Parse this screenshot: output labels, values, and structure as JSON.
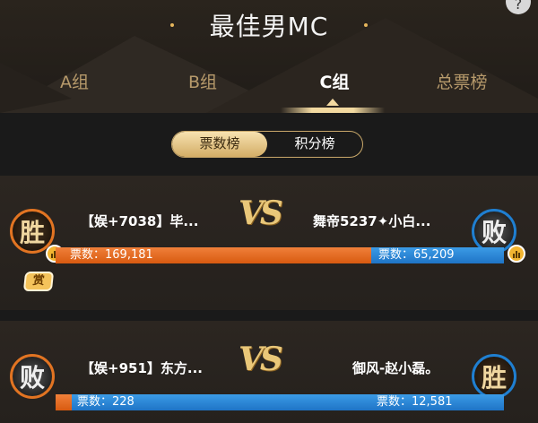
{
  "header": {
    "title": "最佳男MC",
    "tabs": [
      {
        "label": "A组",
        "active": false
      },
      {
        "label": "B组",
        "active": false
      },
      {
        "label": "C组",
        "active": true
      },
      {
        "label": "总票榜",
        "active": false
      }
    ]
  },
  "toggle": {
    "options": [
      "票数榜",
      "积分榜"
    ],
    "selected": "票数榜"
  },
  "matches": [
    {
      "left": {
        "name": "【娱+7038】毕...",
        "result": "胜",
        "votes": "票数：169,181"
      },
      "right": {
        "name": "舞帝5237✦小白...",
        "result": "败",
        "votes": "票数：65,209"
      },
      "vs": "VS",
      "reward": "赏"
    },
    {
      "left": {
        "name": "【娱+951】东方...",
        "result": "败",
        "votes": "票数：228"
      },
      "right": {
        "name": "御风-赵小磊。",
        "result": "胜",
        "votes": "票数：12,581"
      },
      "vs": "VS"
    }
  ],
  "colors": {
    "orange": "#e06a1c",
    "blue": "#2a86d6",
    "gold": "#e9c779",
    "background": "#1f1f1f"
  }
}
